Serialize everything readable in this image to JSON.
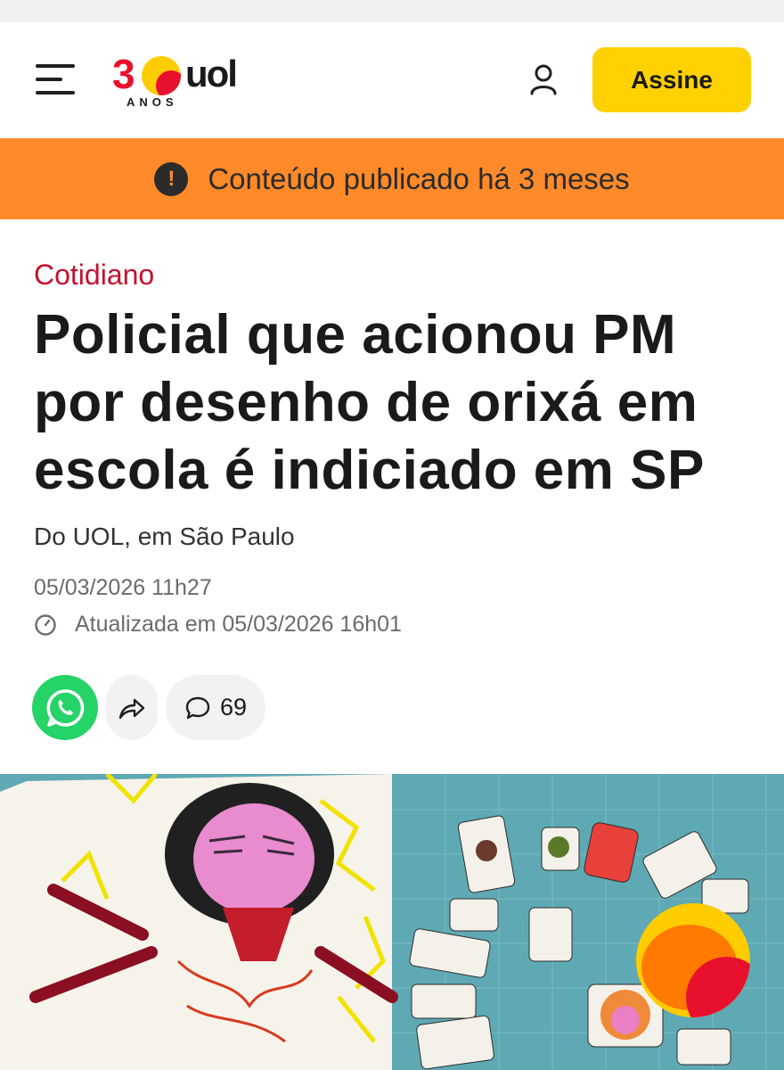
{
  "header": {
    "logo": {
      "number": "30",
      "brand": "UOL",
      "sub": "ANOS"
    },
    "subscribe_label": "Assine",
    "icons": {
      "menu": "menu-icon",
      "user": "user-icon"
    }
  },
  "notice": {
    "text": "Conteúdo publicado há 3 meses",
    "icon": "alert-icon"
  },
  "article": {
    "category": "Cotidiano",
    "headline": "Policial que acionou PM por desenho de orixá em escola é indiciado em SP",
    "byline": "Do UOL, em São Paulo",
    "published": "05/03/2026 11h27",
    "updated": "Atualizada em 05/03/2026 16h01"
  },
  "actions": {
    "whatsapp_icon": "whatsapp-icon",
    "share_icon": "share-icon",
    "comments_icon": "comment-icon",
    "comments_count": "69"
  },
  "colors": {
    "brand_yellow": "#ffd100",
    "notice_orange": "#ff8a2a",
    "category_red": "#c6102e",
    "whatsapp_green": "#25d366"
  }
}
